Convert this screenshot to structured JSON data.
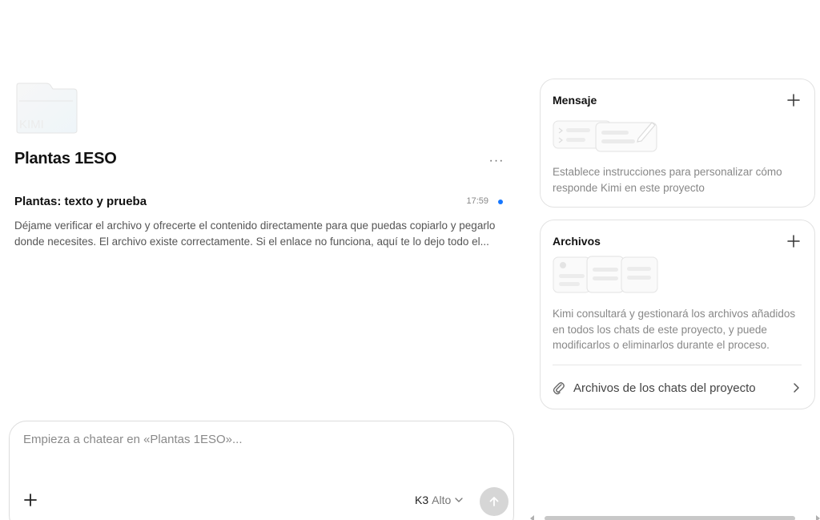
{
  "project": {
    "title": "Plantas 1ESO",
    "folder_watermark": "KIMI",
    "more_label": "···"
  },
  "chats": [
    {
      "title": "Plantas: texto y prueba",
      "time": "17:59",
      "preview": "Déjame verificar el archivo y ofrecerte el contenido directamente para que puedas copiarlo y pegarlo donde necesites. El archivo existe correctamente. Si el enlace no funciona, aquí te lo dejo todo el..."
    }
  ],
  "composer": {
    "placeholder": "Empieza a chatear en «Plantas 1ESO»...",
    "model": "K3",
    "level": "Alto"
  },
  "cards": {
    "message": {
      "title": "Mensaje",
      "description": "Establece instrucciones para personalizar cómo responde Kimi en este proyecto"
    },
    "files": {
      "title": "Archivos",
      "description": "Kimi consultará y gestionará los archivos añadidos en todos los chats de este proyecto, y puede modificarlos o eliminarlos durante el proceso.",
      "link_label": "Archivos de los chats del proyecto"
    }
  },
  "colors": {
    "accent": "#1677ff",
    "send_disabled": "#d6d6d6",
    "border": "#e2e2e2"
  },
  "icons": [
    "folder-icon",
    "more-icon",
    "plus-icon",
    "chevron-down-icon",
    "arrow-up-icon",
    "paperclip-icon",
    "chevron-right-icon"
  ]
}
